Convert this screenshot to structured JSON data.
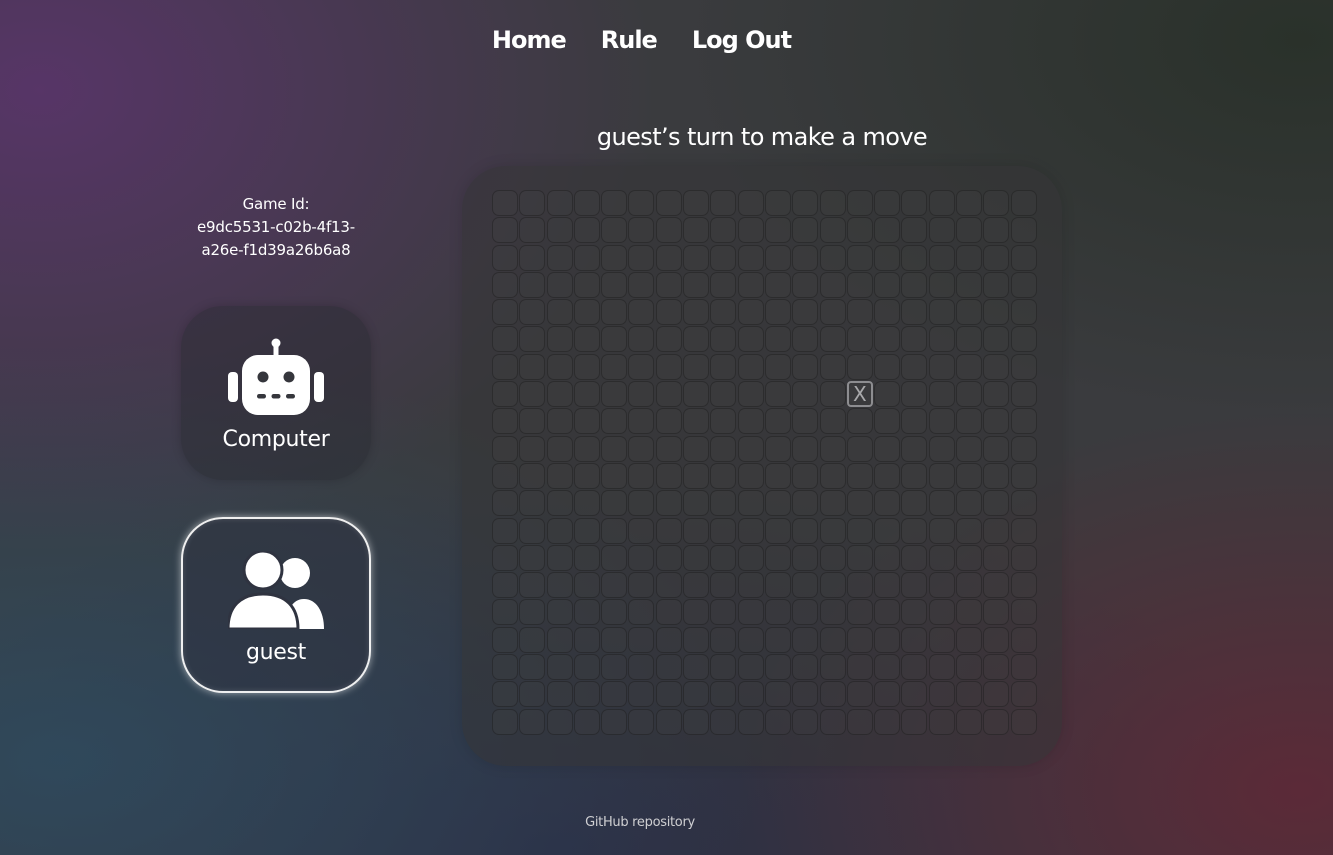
{
  "nav": {
    "home": "Home",
    "rule": "Rule",
    "logout": "Log Out"
  },
  "status": {
    "turn_text": "guest’s turn to make a move"
  },
  "game": {
    "id_label": "Game Id:",
    "id_value": "e9dc5531-c02b-4f13-a26e-f1d39a26b6a8"
  },
  "players": [
    {
      "name": "Computer",
      "icon": "robot-icon",
      "active": false
    },
    {
      "name": "guest",
      "icon": "users-icon",
      "active": true
    }
  ],
  "board": {
    "rows": 20,
    "cols": 20,
    "moves": [
      {
        "row": 7,
        "col": 13,
        "mark": "X"
      }
    ]
  },
  "footer": {
    "github_label": "GitHub repository"
  }
}
